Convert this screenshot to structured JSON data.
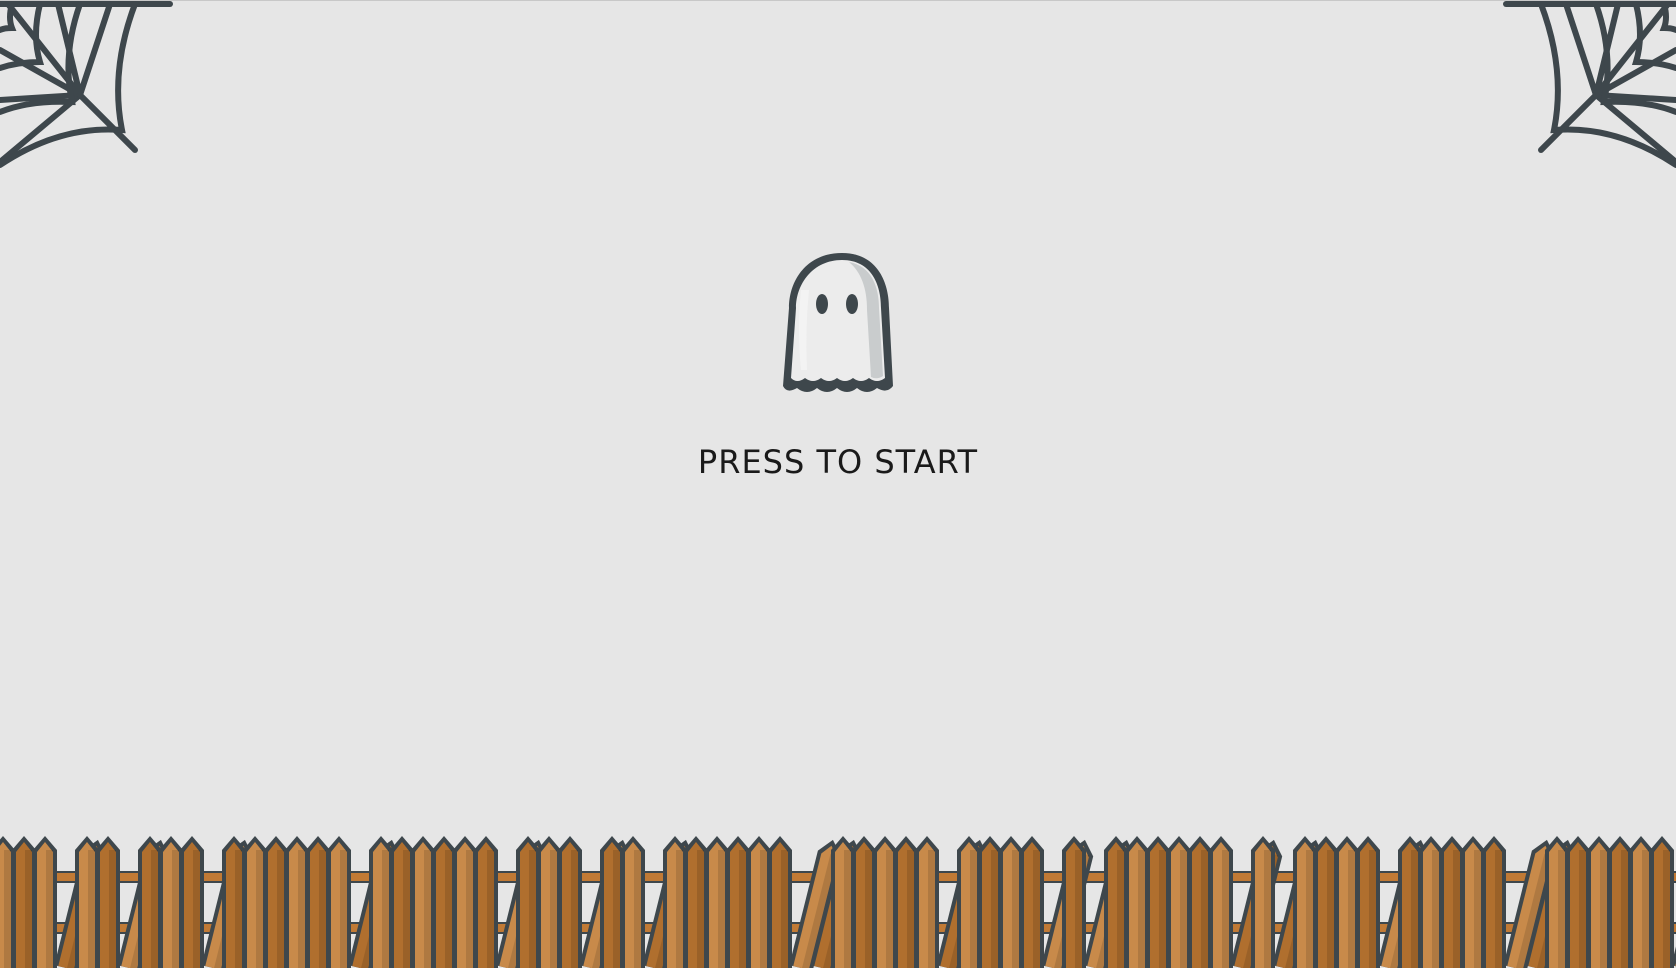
{
  "game": {
    "start_prompt": "PRESS TO START",
    "player_icon": "ghost-icon",
    "decorations": [
      "spider-web-icon",
      "spider-web-icon",
      "picket-fence"
    ]
  },
  "colors": {
    "background": "#e6e6e6",
    "outline": "#3e474c",
    "ghost_body": "#ececec",
    "ghost_shade": "#c9cccd",
    "fence_wood": "#b06f2e",
    "fence_wood_light": "#c88a4a",
    "fence_rail": "#c17a35",
    "text": "#1a1a1a"
  }
}
